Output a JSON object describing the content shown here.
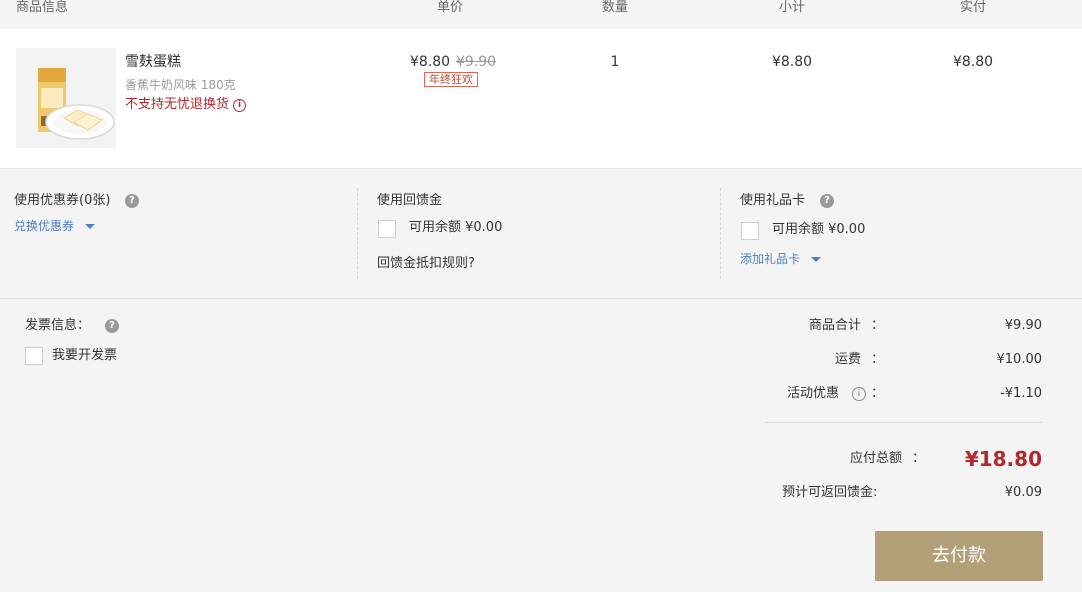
{
  "header": {
    "product_info": "商品信息",
    "unit_price": "单价",
    "quantity": "数量",
    "subtotal": "小计",
    "paid": "实付"
  },
  "product": {
    "name": "雪麸蛋糕",
    "spec": "香蕉牛奶风味 180克",
    "notice": "不支持无忧退换货",
    "notice_icon": "info-circle-icon",
    "price": "¥8.80",
    "original_price": "¥9.90",
    "promo_badge": "年终狂欢",
    "quantity": "1",
    "subtotal": "¥8.80",
    "paid": "¥8.80"
  },
  "coupon": {
    "title": "使用优惠券(0张)",
    "help_icon": "question-circle-icon",
    "redeem_link": "兑换优惠券",
    "dropdown_icon": "caret-down-icon"
  },
  "rebate": {
    "title": "使用回馈金",
    "checked": false,
    "balance_label": "可用余额 ¥0.00",
    "rules_link": "回馈金抵扣规则?"
  },
  "gift_card": {
    "title": "使用礼品卡",
    "help_icon": "question-circle-icon",
    "checked": false,
    "balance_label": "可用余额 ¥0.00",
    "add_link": "添加礼品卡",
    "dropdown_icon": "caret-down-icon"
  },
  "invoice": {
    "title": "发票信息：",
    "help_icon": "question-circle-icon",
    "checked": false,
    "checkbox_label": "我要开发票"
  },
  "summary": {
    "colon": "：",
    "items_total_label": "商品合计",
    "items_total": "¥9.90",
    "shipping_label": "运费",
    "shipping": "¥10.00",
    "discount_label": "活动优惠",
    "discount_icon": "info-circle-icon",
    "discount": "-¥1.10",
    "payable_label": "应付总额",
    "payable": "¥18.80",
    "rebate_label": "预计可返回馈金:",
    "rebate": "¥0.09"
  },
  "pay_button": "去付款",
  "colors": {
    "red": "#b4282d",
    "tan": "#b4a078",
    "link": "#4f7fc0"
  }
}
